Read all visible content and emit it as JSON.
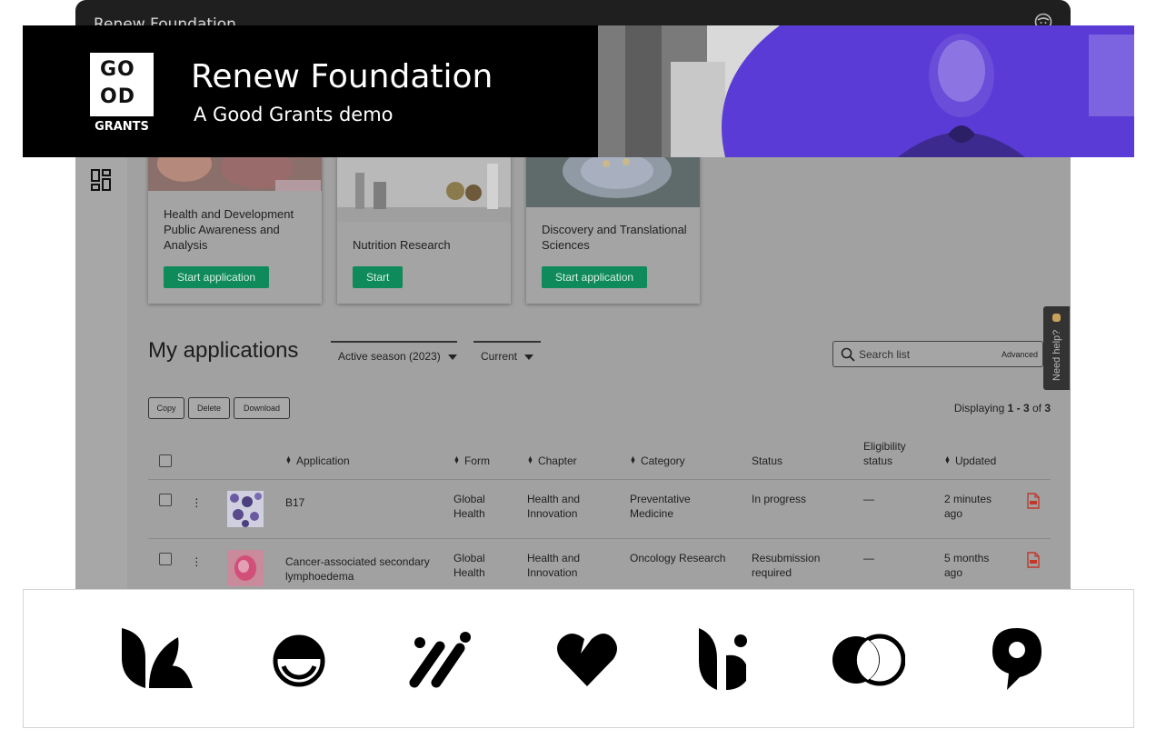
{
  "app": {
    "title": "Renew Foundation"
  },
  "banner": {
    "logo_line1": "GO",
    "logo_line2": "OD",
    "logo_caption": "GRANTS",
    "title": "Renew Foundation",
    "subtitle": "A Good Grants demo",
    "accent_color": "#5b3bd6"
  },
  "cards": [
    {
      "title": "Health and Development Public Awareness and Analysis",
      "button": "Start application"
    },
    {
      "title": "Nutrition Research",
      "button": "Start"
    },
    {
      "title": "Discovery and Translational Sciences",
      "button": "Start application"
    }
  ],
  "applications": {
    "title": "My applications",
    "season_filter": "Active season (2023)",
    "status_filter": "Current",
    "search_placeholder": "Search list",
    "advanced_label": "Advanced",
    "help_label": "Need help?",
    "actions": {
      "copy": "Copy",
      "delete": "Delete",
      "download": "Download"
    },
    "displaying_prefix": "Displaying ",
    "displaying_range": "1 - 3",
    "displaying_of": " of ",
    "displaying_total": "3",
    "columns": {
      "application": "Application",
      "form": "Form",
      "chapter": "Chapter",
      "category": "Category",
      "status": "Status",
      "eligibility_line1": "Eligibility",
      "eligibility_line2": "status",
      "updated": "Updated"
    },
    "rows": [
      {
        "name": "B17",
        "form_l1": "Global",
        "form_l2": "Health",
        "chapter_l1": "Health and",
        "chapter_l2": "Innovation",
        "category_l1": "Preventative",
        "category_l2": "Medicine",
        "status_l1": "In progress",
        "status_l2": "",
        "eligibility": "—",
        "updated_l1": "2 minutes",
        "updated_l2": "ago"
      },
      {
        "name_l1": "Cancer-associated secondary",
        "name_l2": "lymphoedema",
        "form_l1": "Global",
        "form_l2": "Health",
        "chapter_l1": "Health and",
        "chapter_l2": "Innovation",
        "category_l1": "Oncology Research",
        "category_l2": "",
        "status_l1": "Resubmission",
        "status_l2": "required",
        "eligibility": "—",
        "updated_l1": "5 months",
        "updated_l2": "ago"
      }
    ]
  },
  "partner_logos": [
    "leaf-k-logo",
    "smile-circle-logo",
    "slash-dots-logo",
    "heart-logo",
    "sprout-logo",
    "overlapping-circles-logo",
    "pin-nine-logo"
  ],
  "colors": {
    "green_button": "#0f8a5a",
    "pdf_red": "#c0392b"
  }
}
